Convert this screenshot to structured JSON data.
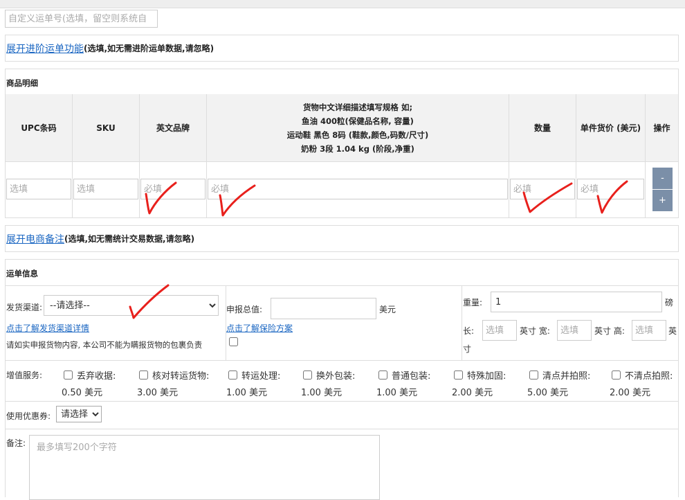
{
  "waybill": {
    "placeholder": "自定义运单号(选填，留空则系统自"
  },
  "advanced": {
    "link": "展开进阶运单功能",
    "note": "(选填,如无需进阶运单数据,请忽略)"
  },
  "goods": {
    "title": "商品明细",
    "columns": {
      "upc": "UPC条码",
      "sku": "SKU",
      "brand": "英文品牌",
      "desc_lines": [
        "货物中文详细描述填写规格 如;",
        "鱼油 400粒(保健品名称, 容量)",
        "运动鞋 黑色 8码 (鞋款,颜色,码数/尺寸)",
        "奶粉 3段 1.04 kg (阶段,净重)"
      ],
      "qty": "数量",
      "price": "单件货价 (美元)",
      "ops": "操作"
    },
    "row": {
      "upc_placeholder": "选填",
      "sku_placeholder": "选填",
      "brand_placeholder": "必填",
      "desc_placeholder": "必填",
      "qty_placeholder": "必填",
      "price_placeholder": "必填"
    },
    "buttons": {
      "remove": "-",
      "add": "+"
    }
  },
  "ecommerce": {
    "link": "展开电商备注",
    "note": "(选填,如无需统计交易数据,请忽略)"
  },
  "shipping": {
    "title": "运单信息",
    "channel_label": "发货渠道:",
    "channel_selected": "--请选择--",
    "channel_link": "点击了解发货渠道详情",
    "channel_note": "请如实申报货物内容, 本公司不能为瞒报货物的包裹负责",
    "declared_label": "申报总值:",
    "declared_value": "",
    "declared_unit": "美元",
    "insurance_link": "点击了解保险方案",
    "weight_label": "重量:",
    "weight_value": "1",
    "weight_unit": "磅",
    "length_label": "长:",
    "width_label": "英寸 宽:",
    "height_label": "英寸 高:",
    "dim_placeholder": "选填",
    "dim_unit_tail": "英",
    "dim_unit_wrap": "寸"
  },
  "services": {
    "label": "增值服务:",
    "items": [
      {
        "name": "丢弃收据:",
        "price": "0.50 美元"
      },
      {
        "name": "核对转运货物:",
        "price": "3.00 美元"
      },
      {
        "name": "转运处理:",
        "price": "1.00 美元"
      },
      {
        "name": "换外包装:",
        "price": "1.00 美元"
      },
      {
        "name": "普通包装:",
        "price": "1.00 美元"
      },
      {
        "name": "特殊加固:",
        "price": "2.00 美元"
      },
      {
        "name": "清点并拍照:",
        "price": "5.00 美元"
      },
      {
        "name": "不清点拍照:",
        "price": "2.00 美元"
      }
    ]
  },
  "coupon": {
    "label": "使用优惠券:",
    "selected": "请选择"
  },
  "remark": {
    "label": "备注:",
    "placeholder": "最多填写200个字符"
  },
  "annotations": {
    "mark_color": "#e8201c"
  }
}
